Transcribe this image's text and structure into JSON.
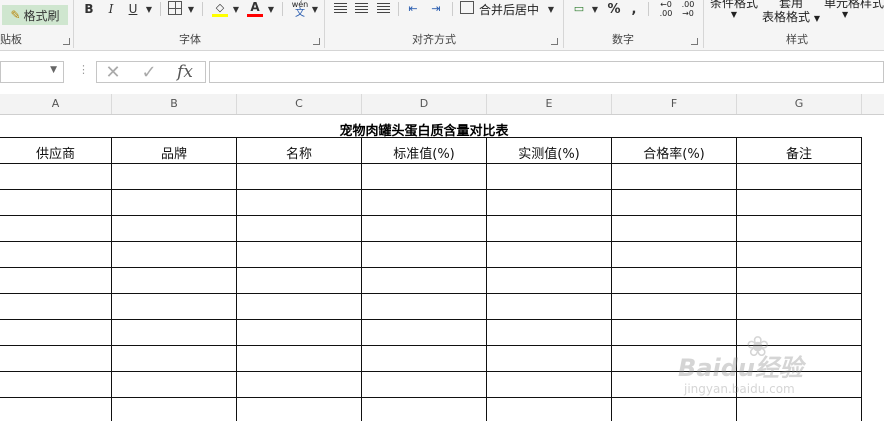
{
  "ribbon": {
    "clipboard": {
      "format_painter_label": "格式刷",
      "group_label": "贴板"
    },
    "font": {
      "bold_label": "B",
      "italic_label": "I",
      "underline_label": "U",
      "phonetic_top": "wén",
      "phonetic_bottom": "文",
      "group_label": "字体",
      "highlight_color": "#ffff00",
      "font_color": "#ff0000"
    },
    "alignment": {
      "merge_label": "合并后居中",
      "group_label": "对齐方式"
    },
    "number": {
      "percent_label": "%",
      "comma_label": ",",
      "increase_decimal_top": "←0",
      "increase_decimal_bottom": ".00",
      "decrease_decimal_top": ".00",
      "decrease_decimal_bottom": "→0",
      "group_label": "数字"
    },
    "styles": {
      "conditional_label": "条件格式",
      "table_top": "套用",
      "table_bottom": "表格格式",
      "cell_styles_label": "单元格样式",
      "group_label": "样式"
    }
  },
  "formula_bar": {
    "namebox_value": "",
    "cancel_icon": "✕",
    "enter_icon": "✓",
    "fx_label": "fx",
    "formula_value": ""
  },
  "columns": [
    "A",
    "B",
    "C",
    "D",
    "E",
    "F",
    "G"
  ],
  "sheet": {
    "title": "宠物肉罐头蛋白质含量对比表",
    "headers": [
      "供应商",
      "品牌",
      "名称",
      "标准值(%)",
      "实测值(%)",
      "合格率(%)",
      "备注"
    ]
  },
  "watermark": {
    "brand": "Baidu经验",
    "url": "jingyan.baidu.com"
  }
}
